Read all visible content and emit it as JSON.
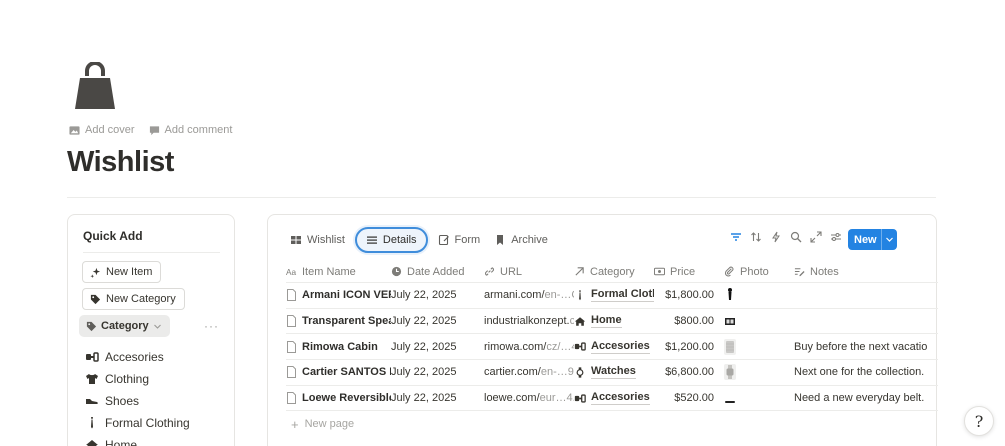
{
  "page": {
    "icon": "shopping-bag-icon",
    "add_cover": "Add cover",
    "add_comment": "Add comment",
    "title": "Wishlist"
  },
  "quick_add": {
    "title": "Quick Add",
    "new_item": "New Item",
    "new_category": "New Category",
    "category_filter": "Category",
    "more": "···",
    "categories": [
      {
        "label": "Accesories",
        "icon": "accessories-icon"
      },
      {
        "label": "Clothing",
        "icon": "tshirt-icon"
      },
      {
        "label": "Shoes",
        "icon": "shoe-icon"
      },
      {
        "label": "Formal Clothing",
        "icon": "tie-icon"
      },
      {
        "label": "Home",
        "icon": "house-icon"
      }
    ]
  },
  "database": {
    "tabs": [
      {
        "label": "Wishlist",
        "icon": "gallery-icon"
      },
      {
        "label": "Details",
        "icon": "list-icon"
      },
      {
        "label": "Form",
        "icon": "form-icon"
      },
      {
        "label": "Archive",
        "icon": "bookmark-icon"
      }
    ],
    "active_tab": "Details",
    "new_button": "New",
    "columns": [
      {
        "label": "Item Name",
        "icon": "text-icon"
      },
      {
        "label": "Date Added",
        "icon": "clock-icon"
      },
      {
        "label": "URL",
        "icon": "link-icon"
      },
      {
        "label": "Category",
        "icon": "relation-arrow-icon"
      },
      {
        "label": "Price",
        "icon": "currency-icon"
      },
      {
        "label": "Photo",
        "icon": "paperclip-icon"
      },
      {
        "label": "Notes",
        "icon": "notes-icon"
      }
    ],
    "rows": [
      {
        "name": "Armani ICON VER",
        "date": "July 22, 2025",
        "url_main": "armani.com/",
        "url_rest": "en-…C",
        "category": "Formal Cloth",
        "category_icon": "tie-icon",
        "price": "$1,800.00",
        "notes": ""
      },
      {
        "name": "Transparent Spea",
        "date": "July 22, 2025",
        "url_main": "industrialkonzept.",
        "url_rest": "c",
        "category": "Home",
        "category_icon": "house-icon",
        "price": "$800.00",
        "notes": ""
      },
      {
        "name": "Rimowa Cabin",
        "date": "July 22, 2025",
        "url_main": "rimowa.com/",
        "url_rest": "cz/…4",
        "category": "Accesories",
        "category_icon": "accessories-icon",
        "price": "$1,200.00",
        "notes": "Buy before the next vacatio"
      },
      {
        "name": "Cartier SANTOS D",
        "date": "July 22, 2025",
        "url_main": "cartier.com/",
        "url_rest": "en-…9",
        "category": "Watches",
        "category_icon": "watch-icon",
        "price": "$6,800.00",
        "notes": "Next one for the collection."
      },
      {
        "name": "Loewe Reversible",
        "date": "July 22, 2025",
        "url_main": "loewe.com/",
        "url_rest": "eur…4.",
        "category": "Accesories",
        "category_icon": "accessories-icon",
        "price": "$520.00",
        "notes": "Need a new everyday belt."
      }
    ],
    "new_page": "New page"
  },
  "colors": {
    "accent": "#2383e2",
    "active_tab_ring": "#3f8ddb",
    "text": "#37352f",
    "muted": "#9b9a97"
  }
}
